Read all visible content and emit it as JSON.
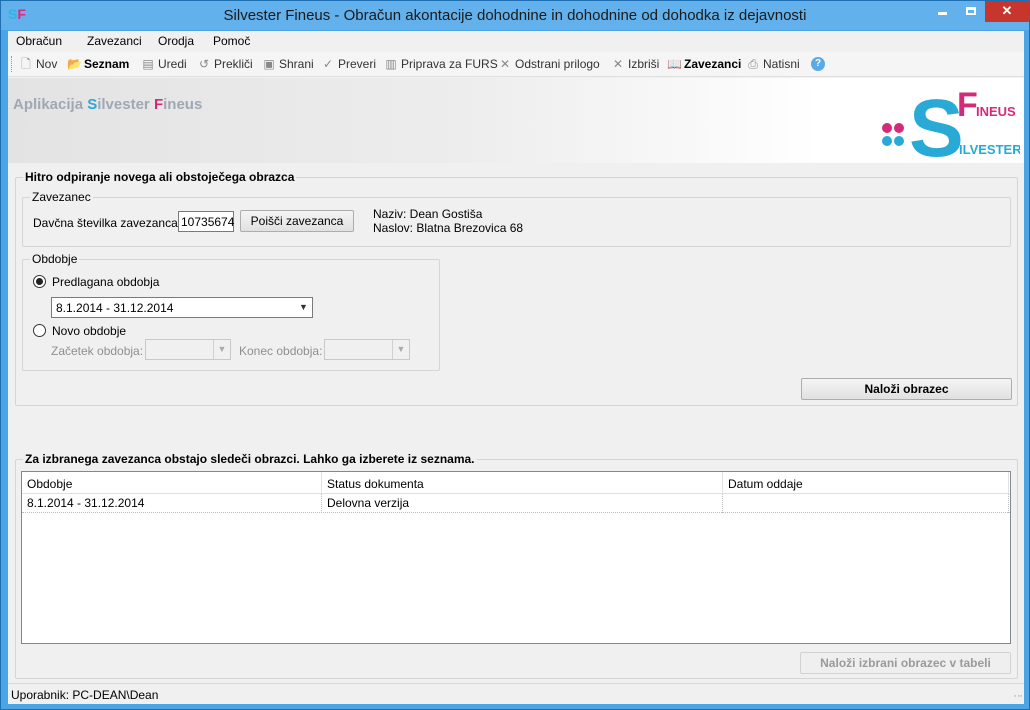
{
  "window": {
    "title": "Silvester Fineus - Obračun akontacije dohodnine in dohodnine od dohodka iz dejavnosti",
    "icon_s": "S",
    "icon_f": "F",
    "minimize_icon": "minimize-icon",
    "maximize_icon": "maximize-icon",
    "close_label": "✕"
  },
  "menu": [
    "Obračun",
    "Zavezanci",
    "Orodja",
    "Pomoč"
  ],
  "toolbar": [
    {
      "label": "Nov",
      "icon": "new-document-icon",
      "glyph": "🗋",
      "enabled": false
    },
    {
      "label": "Seznam",
      "icon": "folder-icon",
      "glyph": "📂",
      "enabled": true
    },
    {
      "label": "Uredi",
      "icon": "edit-icon",
      "glyph": "▤",
      "enabled": false
    },
    {
      "label": "Prekliči",
      "icon": "undo-icon",
      "glyph": "↺",
      "enabled": false
    },
    {
      "label": "Shrani",
      "icon": "save-icon",
      "glyph": "▣",
      "enabled": false
    },
    {
      "label": "Preveri",
      "icon": "spellcheck-icon",
      "glyph": "✓",
      "enabled": false
    },
    {
      "label": "Priprava za FURS",
      "icon": "prepare-icon",
      "glyph": "▥",
      "enabled": false
    },
    {
      "label": "Odstrani prilogo",
      "icon": "remove-icon",
      "glyph": "✕",
      "enabled": false
    },
    {
      "label": "Izbriši",
      "icon": "delete-icon",
      "glyph": "✕",
      "enabled": false
    },
    {
      "label": "Zavezanci",
      "icon": "address-book-icon",
      "glyph": "📖",
      "enabled": true
    },
    {
      "label": "Natisni",
      "icon": "print-icon",
      "glyph": "⎙",
      "enabled": false
    },
    {
      "label": "",
      "icon": "help-icon",
      "glyph": "?",
      "enabled": true
    }
  ],
  "banner": {
    "prefix": "Aplikacija ",
    "s": "S",
    "ilvester": "ilvester ",
    "f": "F",
    "ineus": "ineus",
    "logo_ineus": "INEUS",
    "logo_ilvester": "ILVESTER",
    "colors": {
      "cyan": "#29a9d6",
      "magenta": "#d42a78"
    }
  },
  "quick_open": {
    "title": "Hitro odpiranje novega ali obstoječega obrazca",
    "taxpayer": {
      "group_title": "Zavezanec",
      "tax_number_label": "Davčna številka zavezanca:",
      "tax_number_value": "10735674",
      "search_button": "Poišči zavezanca",
      "name_line": "Naziv: Dean Gostiša",
      "address_line": "Naslov: Blatna Brezovica 68"
    },
    "period": {
      "group_title": "Obdobje",
      "suggested_label": "Predlagana obdobja",
      "suggested_selected": true,
      "suggested_value": "8.1.2014 - 31.12.2014",
      "new_label": "Novo obdobje",
      "start_label": "Začetek obdobja:",
      "end_label": "Konec obdobja:"
    },
    "load_button": "Naloži obrazec"
  },
  "existing": {
    "title": "Za izbranega zavezanca obstajo sledeči obrazci. Lahko ga izberete iz seznama.",
    "columns": [
      "Obdobje",
      "Status dokumenta",
      "Datum oddaje"
    ],
    "rows": [
      [
        "8.1.2014 - 31.12.2014",
        "Delovna verzija",
        ""
      ]
    ],
    "load_selected_button": "Naloži izbrani obrazec v tabeli"
  },
  "status": {
    "user": "Uporabnik: PC-DEAN\\Dean"
  }
}
